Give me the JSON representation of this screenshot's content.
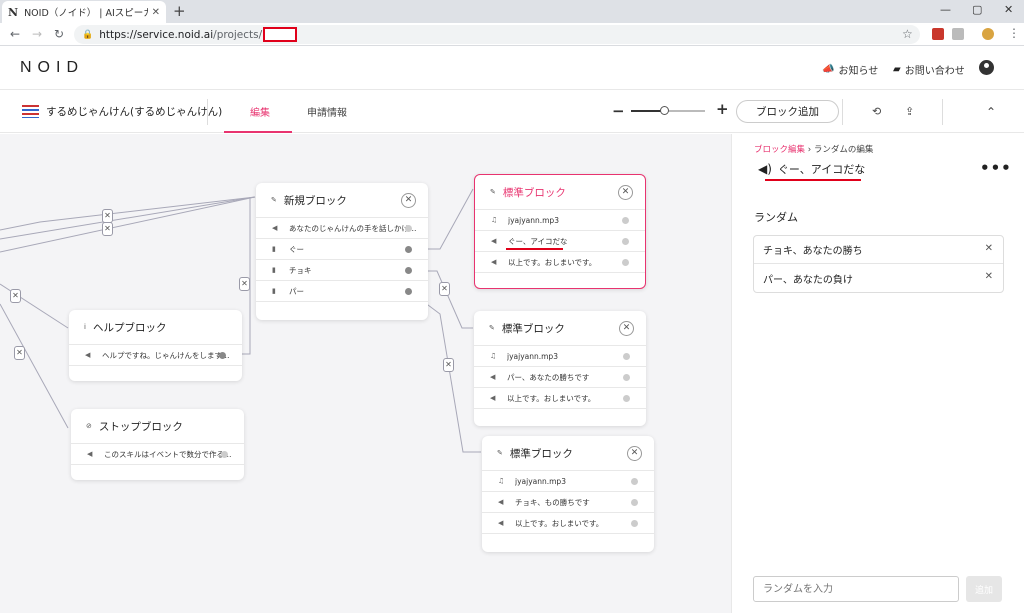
{
  "browser": {
    "tab_title": "NOID（ノイド） | AIスピーカースキル",
    "tab_favicon": "N",
    "url_host": "https://service.noid.ai",
    "url_path": "/projects/"
  },
  "header": {
    "logo": "NOID",
    "news": "お知らせ",
    "contact": "お問い合わせ"
  },
  "project": {
    "name": "するめじゃんけん(するめじゃんけん)",
    "tabs": [
      "編集",
      "申請情報"
    ],
    "active_tab": "編集",
    "add_block": "ブロック追加",
    "zoom_fraction": 0.45
  },
  "blocks": {
    "new": {
      "title": "新規ブロック",
      "rows": [
        "あなたのじゃんけんの手を話しかけ…",
        "ぐー",
        "チョキ",
        "パー"
      ]
    },
    "help": {
      "title": "ヘルプブロック",
      "rows": [
        "ヘルプですね。じゃんけんをします…"
      ]
    },
    "stop": {
      "title": "ストップブロック",
      "rows": [
        "このスキルはイベントで数分で作る…"
      ]
    },
    "std1": {
      "title": "標準ブロック",
      "rows": [
        "jyajyann.mp3",
        "ぐー、アイコだな",
        "以上です。おしまいです。"
      ]
    },
    "std2": {
      "title": "標準ブロック",
      "rows": [
        "jyajyann.mp3",
        "パー、あなたの勝ちです",
        "以上です。おしまいです。"
      ]
    },
    "std3": {
      "title": "標準ブロック",
      "rows": [
        "jyajyann.mp3",
        "チョキ、もの勝ちです",
        "以上です。おしまいです。"
      ]
    }
  },
  "panel": {
    "breadcrumb_parent": "ブロック編集",
    "breadcrumb_sep": "›",
    "breadcrumb_current": "ランダムの編集",
    "title": "ぐー、アイコだな",
    "section": "ランダム",
    "items": [
      "チョキ、あなたの勝ち",
      "パー、あなたの負け"
    ],
    "input_placeholder": "ランダムを入力",
    "add_label": "追加"
  },
  "colors": {
    "accent": "#e8336f",
    "annotation": "#e0001a",
    "canvas": "#f4f4f6"
  }
}
